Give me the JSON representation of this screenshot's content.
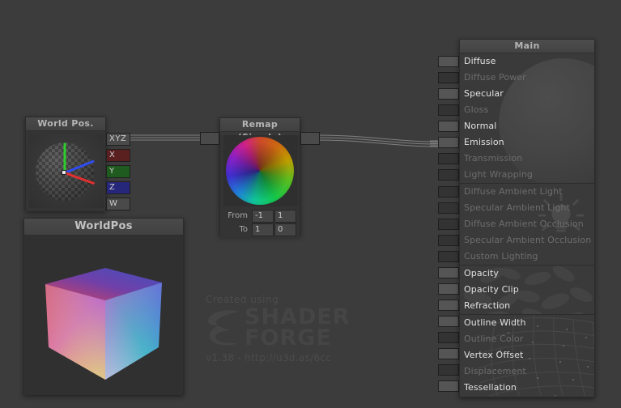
{
  "background_color": "#3c3c3c",
  "nodes": {
    "world_pos": {
      "title": "World Pos.",
      "outputs": [
        {
          "label": "XYZ",
          "color": "#4a4a4a"
        },
        {
          "label": "X",
          "color": "#5a2020"
        },
        {
          "label": "Y",
          "color": "#1f5a1f"
        },
        {
          "label": "Z",
          "color": "#26267a"
        },
        {
          "label": "W",
          "color": "#4a4a4a"
        }
      ]
    },
    "remap": {
      "title": "Remap (Simple)",
      "fields": [
        {
          "label": "From",
          "a": "-1",
          "b": "1"
        },
        {
          "label": "To",
          "a": "1",
          "b": "0"
        }
      ]
    },
    "worldpos_preview": {
      "title": "WorldPos"
    },
    "main": {
      "title": "Main",
      "sections": [
        {
          "name": "lighting",
          "items": [
            {
              "label": "Diffuse",
              "enabled": true
            },
            {
              "label": "Diffuse Power",
              "enabled": false
            },
            {
              "label": "Specular",
              "enabled": true
            },
            {
              "label": "Gloss",
              "enabled": false
            },
            {
              "label": "Normal",
              "enabled": true
            },
            {
              "label": "Emission",
              "enabled": true
            },
            {
              "label": "Transmission",
              "enabled": false
            },
            {
              "label": "Light Wrapping",
              "enabled": false
            }
          ]
        },
        {
          "name": "ambient",
          "items": [
            {
              "label": "Diffuse Ambient Light",
              "enabled": false
            },
            {
              "label": "Specular Ambient Light",
              "enabled": false
            },
            {
              "label": "Diffuse Ambient Occlusion",
              "enabled": false
            },
            {
              "label": "Specular Ambient Occlusion",
              "enabled": false
            },
            {
              "label": "Custom Lighting",
              "enabled": false
            }
          ]
        },
        {
          "name": "opacity",
          "items": [
            {
              "label": "Opacity",
              "enabled": true
            },
            {
              "label": "Opacity Clip",
              "enabled": true
            },
            {
              "label": "Refraction",
              "enabled": true
            }
          ]
        },
        {
          "name": "vertex",
          "items": [
            {
              "label": "Outline Width",
              "enabled": true
            },
            {
              "label": "Outline Color",
              "enabled": false
            },
            {
              "label": "Vertex Offset",
              "enabled": true
            },
            {
              "label": "Displacement",
              "enabled": false
            },
            {
              "label": "Tessellation",
              "enabled": true
            }
          ]
        }
      ]
    }
  },
  "watermark": {
    "created_using": "Created using",
    "word1": "SHADER",
    "word2": "FORGE",
    "version_url": "v1.38 - http://u3d.as/6cc"
  }
}
